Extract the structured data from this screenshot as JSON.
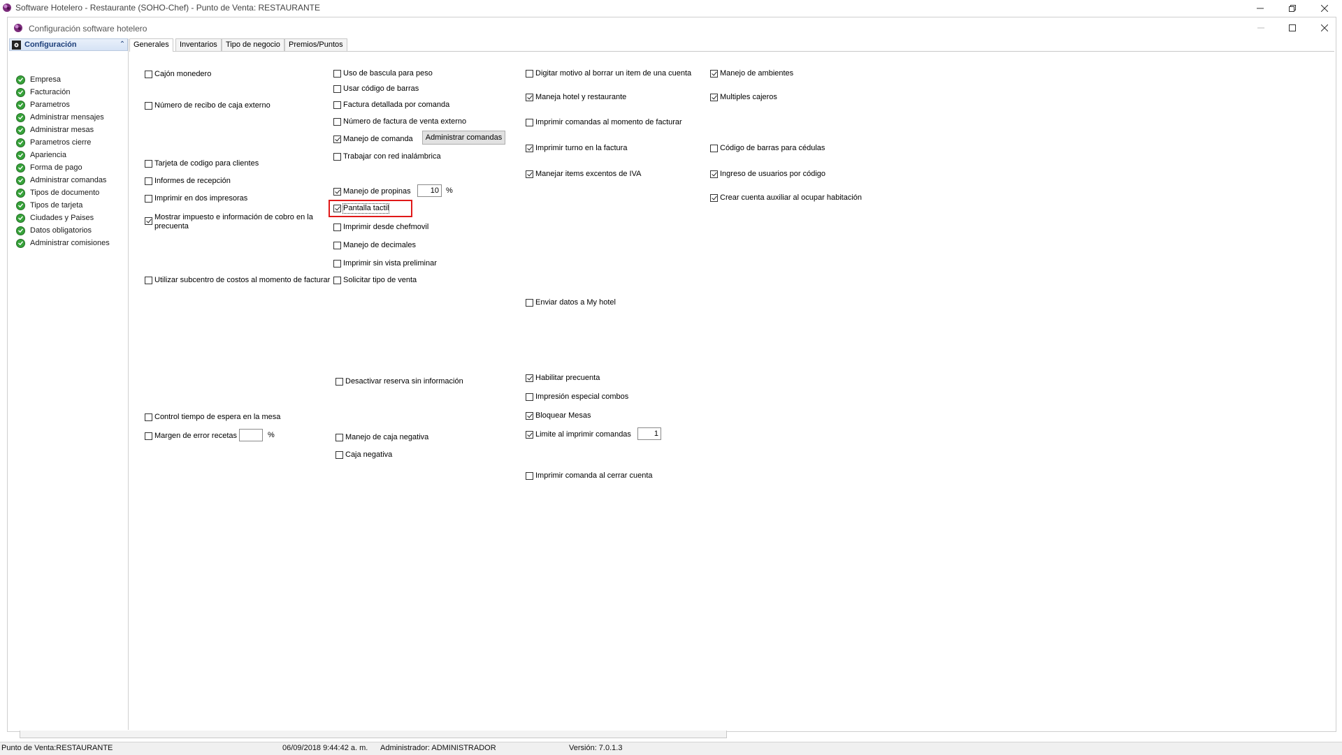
{
  "app": {
    "title": "Software  Hotelero - Restaurante (SOHO-Chef)  - Punto de Venta: RESTAURANTE"
  },
  "window": {
    "title": "Configuración software hotelero"
  },
  "nav": {
    "header": "Configuración",
    "items": [
      "Empresa",
      "Facturación",
      "Parametros",
      "Administrar mensajes",
      "Administrar mesas",
      "Parametros cierre",
      "Apariencia",
      "Forma de pago",
      "Administrar comandas",
      "Tipos de documento",
      "Tipos de tarjeta",
      "Ciudades y Paises",
      "Datos obligatorios",
      "Administrar comisiones"
    ]
  },
  "tabs": [
    "Generales",
    "Inventarios",
    "Tipo de negocio",
    "Premios/Puntos"
  ],
  "options": {
    "cajon_monedero": {
      "label": "Cajón monedero",
      "checked": false
    },
    "num_recibo_caja": {
      "label": "Número de recibo de caja externo",
      "checked": false
    },
    "tarjeta_codigo": {
      "label": "Tarjeta de codigo para clientes",
      "checked": false
    },
    "informes_recepcion": {
      "label": "Informes de recepción",
      "checked": false
    },
    "imprimir_dos": {
      "label": "Imprimir en dos impresoras",
      "checked": false
    },
    "mostrar_impuesto": {
      "label": "Mostrar impuesto e información de cobro en la precuenta",
      "checked": true
    },
    "subcentro_costos": {
      "label": "Utilizar subcentro de costos al momento de facturar",
      "checked": false
    },
    "control_tiempo": {
      "label": "Control tiempo de espera en la mesa",
      "checked": false
    },
    "margen_error": {
      "label": "Margen de error recetas",
      "checked": false,
      "value": ""
    },
    "uso_bascula": {
      "label": "Uso de bascula para peso",
      "checked": false
    },
    "codigo_barras": {
      "label": "Usar código de barras",
      "checked": false
    },
    "factura_detallada": {
      "label": "Factura detallada por comanda",
      "checked": false
    },
    "num_factura_venta": {
      "label": "Número de factura de venta externo",
      "checked": false
    },
    "manejo_comanda": {
      "label": "Manejo de comanda",
      "checked": true
    },
    "red_inalambrica": {
      "label": "Trabajar con red inalámbrica",
      "checked": false
    },
    "manejo_propinas": {
      "label": "Manejo de propinas",
      "checked": true,
      "value": "10"
    },
    "pantalla_tactil": {
      "label": "Pantalla tactil",
      "checked": true
    },
    "imprimir_chefmovil": {
      "label": "Imprimir desde chefmovil",
      "checked": false
    },
    "manejo_decimales": {
      "label": "Manejo de decimales",
      "checked": false
    },
    "imprimir_sin_vista": {
      "label": "Imprimir sin vista preliminar",
      "checked": false
    },
    "solicitar_tipo_venta": {
      "label": "Solicitar tipo de venta",
      "checked": false
    },
    "desactivar_reserva": {
      "label": "Desactivar reserva sin información",
      "checked": false
    },
    "caja_negativa_manejo": {
      "label": "Manejo de caja negativa",
      "checked": false
    },
    "caja_negativa": {
      "label": "Caja negativa",
      "checked": false
    },
    "digitar_motivo": {
      "label": "Digitar motivo al borrar un item de una cuenta",
      "checked": false
    },
    "hotel_restaurante": {
      "label": "Maneja hotel y restaurante",
      "checked": true
    },
    "imprimir_comandas_facturar": {
      "label": "Imprimir comandas al momento de facturar",
      "checked": false
    },
    "imprimir_turno": {
      "label": "Imprimir turno en la factura",
      "checked": true
    },
    "items_excentos": {
      "label": "Manejar items excentos de IVA",
      "checked": true
    },
    "enviar_myhotel": {
      "label": "Enviar datos a My hotel",
      "checked": false
    },
    "habilitar_precuenta": {
      "label": "Habilitar precuenta",
      "checked": true
    },
    "impresion_combos": {
      "label": "Impresión especial combos",
      "checked": false
    },
    "bloquear_mesas": {
      "label": "Bloquear Mesas",
      "checked": true
    },
    "limite_imprimir": {
      "label": "Limite al imprimir comandas",
      "checked": true,
      "value": "1"
    },
    "imprimir_cerrar": {
      "label": "Imprimir comanda al cerrar cuenta",
      "checked": false
    },
    "manejo_ambientes": {
      "label": "Manejo de ambientes",
      "checked": true
    },
    "multiples_cajeros": {
      "label": "Multiples cajeros",
      "checked": true
    },
    "barras_cedulas": {
      "label": "Código de barras para cédulas",
      "checked": false
    },
    "ingreso_usuarios": {
      "label": "Ingreso de usuarios por código",
      "checked": true
    },
    "cuenta_auxiliar": {
      "label": "Crear cuenta auxiliar al ocupar habitación",
      "checked": true
    }
  },
  "percent_sign": "%",
  "admin_comandas_button": "Administrar comandas",
  "status": {
    "punto": "Punto de Venta:RESTAURANTE",
    "fecha": "06/09/2018 9:44:42 a. m.",
    "usuario": "Administrador: ADMINISTRADOR",
    "version": "Versión: 7.0.1.3"
  }
}
